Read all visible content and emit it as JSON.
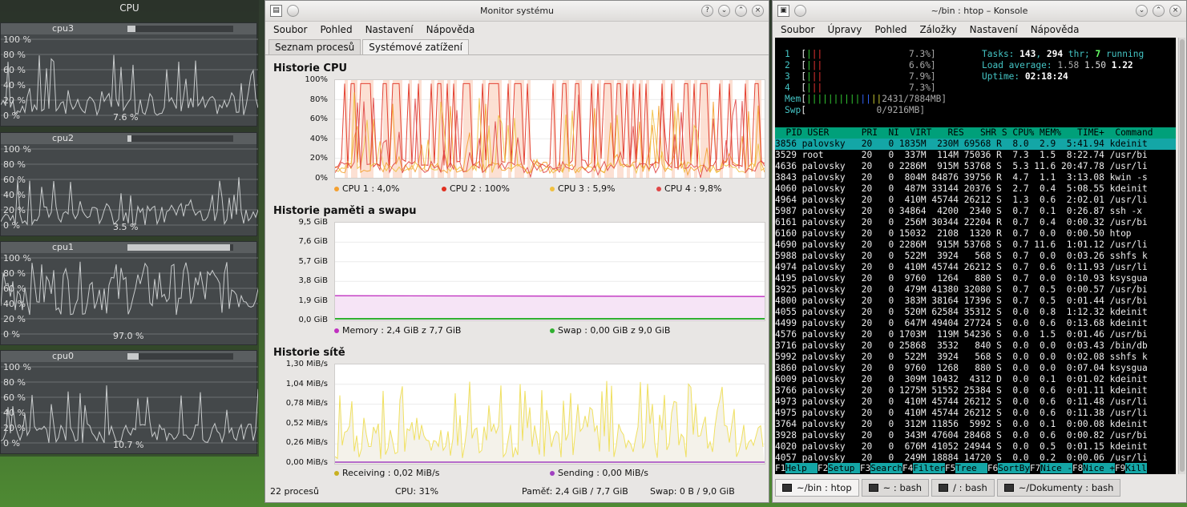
{
  "cpu_widget": {
    "title": "CPU",
    "yticks": [
      "100 %",
      "80 %",
      "60 %",
      "40 %",
      "20 %",
      "0 %"
    ],
    "panels": [
      {
        "name": "cpu3",
        "current": "7.6 %",
        "load": 0.076
      },
      {
        "name": "cpu2",
        "current": "3.5 %",
        "load": 0.035
      },
      {
        "name": "cpu1",
        "current": "97.0 %",
        "load": 0.97
      },
      {
        "name": "cpu0",
        "current": "10.7 %",
        "load": 0.107
      }
    ]
  },
  "sysmon": {
    "title": "Monitor systému",
    "menu": [
      "Soubor",
      "Pohled",
      "Nastavení",
      "Nápověda"
    ],
    "tabs": [
      "Seznam procesů",
      "Systémové zatížení"
    ],
    "cpu": {
      "title": "Historie CPU",
      "yticks": [
        "100%",
        "80%",
        "60%",
        "40%",
        "20%",
        "0%"
      ],
      "legend": [
        {
          "label": "CPU 1 : 4,0%",
          "color": "#f4a030"
        },
        {
          "label": "CPU 2 : 100%",
          "color": "#e03020"
        },
        {
          "label": "CPU 3 : 5,9%",
          "color": "#f0c040"
        },
        {
          "label": "CPU 4 : 9,8%",
          "color": "#e04848"
        }
      ]
    },
    "mem": {
      "title": "Historie paměti a swapu",
      "yticks": [
        "9,5 GiB",
        "7,6 GiB",
        "5,7 GiB",
        "3,8 GiB",
        "1,9 GiB",
        "0,0 GiB"
      ],
      "legend": [
        {
          "label": "Memory : 2,4 GiB z 7,7 GiB",
          "color": "#c030c0"
        },
        {
          "label": "Swap : 0,00 GiB z 9,0 GiB",
          "color": "#30b030"
        }
      ]
    },
    "net": {
      "title": "Historie sítě",
      "yticks": [
        "1,30 MiB/s",
        "1,04 MiB/s",
        "0,78 MiB/s",
        "0,52 MiB/s",
        "0,26 MiB/s",
        "0,00 MiB/s"
      ],
      "legend": [
        {
          "label": "Receiving : 0,02 MiB/s",
          "color": "#c8b020"
        },
        {
          "label": "Sending : 0,00 MiB/s",
          "color": "#a040c0"
        }
      ]
    },
    "status": {
      "procs": "22 procesů",
      "cpu": "CPU: 31%",
      "mem": "Paměť: 2,4 GiB / 7,7 GiB",
      "swap": "Swap: 0 B / 9,0 GiB"
    }
  },
  "konsole": {
    "title": "~/bin : htop – Konsole",
    "menu": [
      "Soubor",
      "Úpravy",
      "Pohled",
      "Záložky",
      "Nastavení",
      "Nápověda"
    ],
    "htop": {
      "cpus": [
        {
          "n": "1",
          "bar": "|||",
          "pct": "7.3%]"
        },
        {
          "n": "2",
          "bar": "|||",
          "pct": "6.6%]"
        },
        {
          "n": "3",
          "bar": "|||",
          "pct": "7.9%]"
        },
        {
          "n": "4",
          "bar": "|||",
          "pct": "7.3%]"
        }
      ],
      "mem_bar": "||||||||||||||",
      "mem_val": "2431/7884MB]",
      "swp_val": "0/9216MB]",
      "tasks": "143",
      "thr": "294",
      "running": "7",
      "load1": "1.58",
      "load5": "1.50",
      "load15": "1.22",
      "uptime": "02:18:24",
      "tasks_label": "Tasks:",
      "thr_label": "thr;",
      "running_label": "running",
      "load_label": "Load average:",
      "uptime_label": "Uptime:",
      "header": "  PID USER      PRI  NI  VIRT   RES   SHR S CPU% MEM%   TIME+  Command",
      "rows": [
        "3856 palovsky   20   0 1835M  230M 69568 R  8.0  2.9  5:41.94 kdeinit",
        "3529 root       20   0  337M  114M 75036 R  7.3  1.5  8:22.74 /usr/bi",
        "4636 palovsky   20   0 2286M  915M 53768 S  5.3 11.6 20:47.78 /usr/li",
        "3843 palovsky   20   0  804M 84876 39756 R  4.7  1.1  3:13.08 kwin -s",
        "4060 palovsky   20   0  487M 33144 20376 S  2.7  0.4  5:08.55 kdeinit",
        "4964 palovsky   20   0  410M 45744 26212 S  1.3  0.6  2:02.01 /usr/li",
        "5987 palovsky   20   0 34864  4200  2340 S  0.7  0.1  0:26.87 ssh -x",
        "6161 palovsky   20   0  256M 30344 22204 R  0.7  0.4  0:00.32 /usr/bi",
        "6160 palovsky   20   0 15032  2108  1320 R  0.7  0.0  0:00.50 htop",
        "4690 palovsky   20   0 2286M  915M 53768 S  0.7 11.6  1:01.12 /usr/li",
        "5988 palovsky   20   0  522M  3924   568 S  0.7  0.0  0:03.26 sshfs k",
        "4974 palovsky   20   0  410M 45744 26212 S  0.7  0.6  0:11.93 /usr/li",
        "4195 palovsky   20   0  9760  1264   880 S  0.7  0.0  0:10.93 ksysgua",
        "3925 palovsky   20   0  479M 41380 32080 S  0.7  0.5  0:00.57 /usr/bi",
        "4800 palovsky   20   0  383M 38164 17396 S  0.7  0.5  0:01.44 /usr/bi",
        "4055 palovsky   20   0  520M 62584 35312 S  0.0  0.8  1:12.32 kdeinit",
        "4499 palovsky   20   0  647M 49404 27724 S  0.0  0.6  0:13.68 kdeinit",
        "4576 palovsky   20   0 1703M  119M 54236 S  0.0  1.5  0:01.46 /usr/bi",
        "3716 palovsky   20   0 25868  3532   840 S  0.0  0.0  0:03.43 /bin/db",
        "5992 palovsky   20   0  522M  3924   568 S  0.0  0.0  0:02.08 sshfs k",
        "3860 palovsky   20   0  9760  1268   880 S  0.0  0.0  0:07.04 ksysgua",
        "6009 palovsky   20   0  309M 10432  4312 D  0.0  0.1  0:01.02 kdeinit",
        "3766 palovsky   20   0 1275M 51552 25384 S  0.0  0.6  0:01.11 kdeinit",
        "4973 palovsky   20   0  410M 45744 26212 S  0.0  0.6  0:11.48 /usr/li",
        "4975 palovsky   20   0  410M 45744 26212 S  0.0  0.6  0:11.38 /usr/li",
        "3764 palovsky   20   0  312M 11856  5992 S  0.0  0.1  0:00.08 kdeinit",
        "3928 palovsky   20   0  343M 47604 28468 S  0.0  0.6  0:00.82 /usr/bi",
        "4020 palovsky   20   0  676M 41052 24944 S  0.0  0.5  0:01.15 kdeinit",
        "4057 palovsky   20   0  249M 18884 14720 S  0.0  0.2  0:00.06 /usr/li"
      ],
      "fkeys": [
        {
          "k": "F1",
          "l": "Help  "
        },
        {
          "k": "F2",
          "l": "Setup "
        },
        {
          "k": "F3",
          "l": "Search"
        },
        {
          "k": "F4",
          "l": "Filter"
        },
        {
          "k": "F5",
          "l": "Tree  "
        },
        {
          "k": "F6",
          "l": "SortBy"
        },
        {
          "k": "F7",
          "l": "Nice -"
        },
        {
          "k": "F8",
          "l": "Nice +"
        },
        {
          "k": "F9",
          "l": "Kill"
        }
      ]
    },
    "tabs": [
      "~/bin : htop",
      "~ : bash",
      "/ : bash",
      "~/Dokumenty : bash"
    ]
  }
}
